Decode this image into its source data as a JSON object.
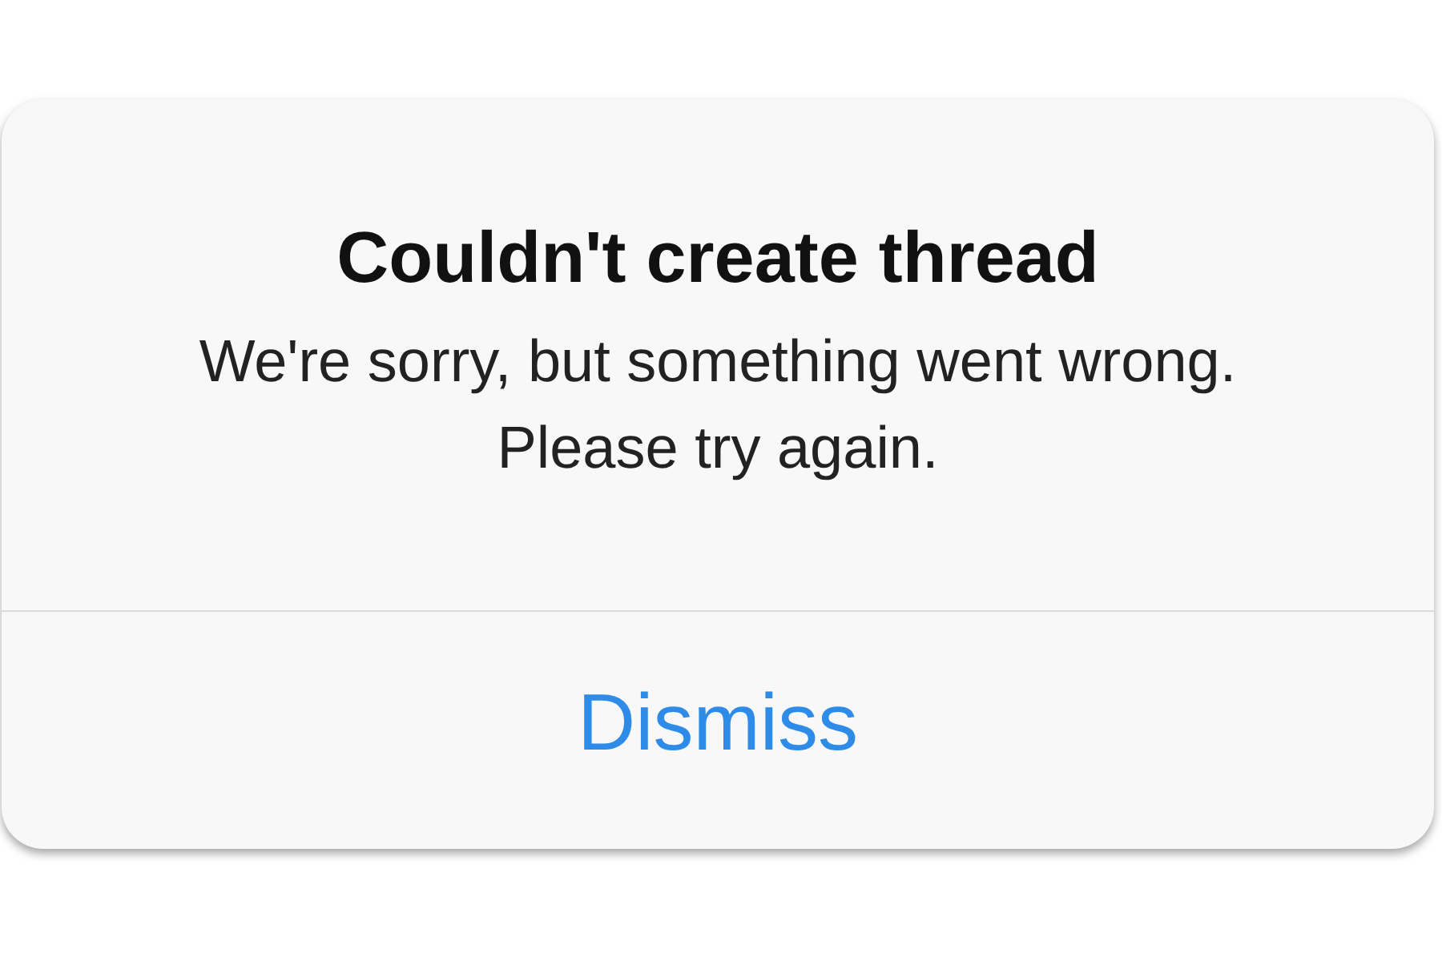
{
  "alert": {
    "title": "Couldn't create thread",
    "message": "We're sorry, but something went wrong. Please try again.",
    "buttons": [
      {
        "label": "Dismiss"
      }
    ]
  }
}
